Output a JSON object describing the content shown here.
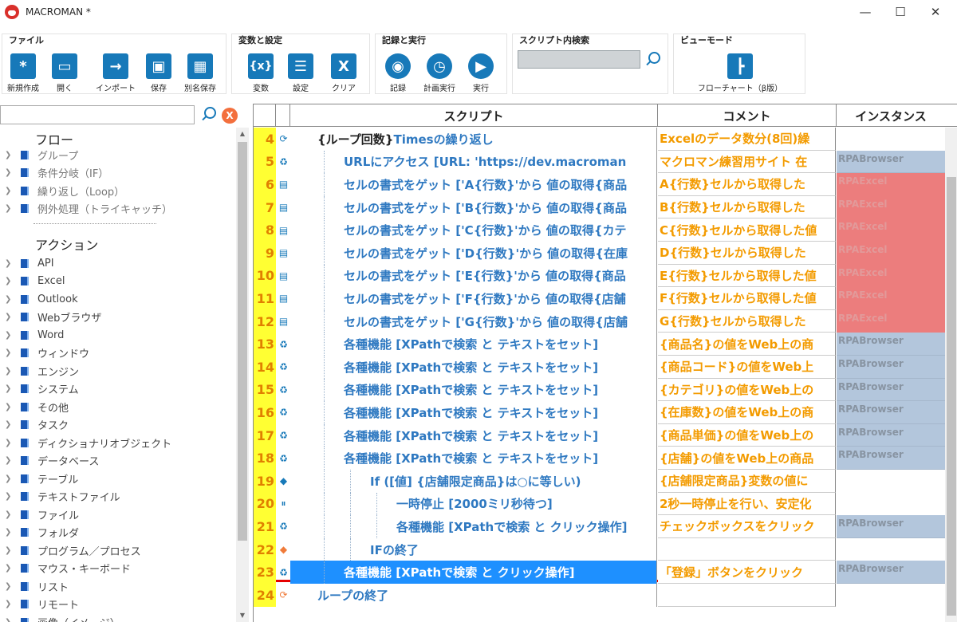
{
  "window": {
    "title": "MACROMAN *"
  },
  "ribbon": {
    "groups": {
      "file": {
        "title": "ファイル",
        "new": "新規作成",
        "open": "開く",
        "import": "インポート",
        "save": "保存",
        "save_as": "別名保存"
      },
      "vars": {
        "title": "変数と設定",
        "variable": "変数",
        "settings": "設定",
        "clear": "クリア"
      },
      "record": {
        "title": "記録と実行",
        "record": "記録",
        "scheduled": "計画実行",
        "run": "実行"
      },
      "search": {
        "title": "スクリプト内検索"
      },
      "view": {
        "title": "ビューモード",
        "flowchart": "フローチャート（β版）"
      }
    }
  },
  "sidebar": {
    "flow_title": "フロー",
    "flow_items": [
      "グループ",
      "条件分岐（IF）",
      "繰り返し（Loop）",
      "例外処理（トライキャッチ）"
    ],
    "action_title": "アクション",
    "action_items": [
      "API",
      "Excel",
      "Outlook",
      "Webブラウザ",
      "Word",
      "ウィンドウ",
      "エンジン",
      "システム",
      "その他",
      "タスク",
      "ディクショナリオブジェクト",
      "データベース",
      "テーブル",
      "テキストファイル",
      "ファイル",
      "フォルダ",
      "プログラム／プロセス",
      "マウス・キーボード",
      "リスト",
      "リモート",
      "画像（イメージ）"
    ]
  },
  "grid": {
    "headers": {
      "script": "スクリプト",
      "comment": "コメント",
      "instance": "インスタンス"
    },
    "rows": [
      {
        "n": "4",
        "icon": "loop-icon",
        "pre": "{ループ回数}",
        "script": " Timesの繰り返し",
        "comment": "Excelのデータ数分(8回)繰",
        "instance": "",
        "itype": "none",
        "indent": 0
      },
      {
        "n": "5",
        "icon": "action-icon",
        "pre": "",
        "script": "URLにアクセス [URL: 'https://dev.macroman",
        "comment": "マクロマン練習用サイト 在",
        "instance": "RPABrowser",
        "itype": "browser",
        "indent": 1
      },
      {
        "n": "6",
        "icon": "doc-icon",
        "pre": "",
        "script": "セルの書式をゲット ['A{行数}'から 値の取得{商品",
        "comment": "A{行数}セルから取得した",
        "instance": "RPAExcel",
        "itype": "excel",
        "indent": 1
      },
      {
        "n": "7",
        "icon": "doc-icon",
        "pre": "",
        "script": "セルの書式をゲット ['B{行数}'から 値の取得{商品",
        "comment": "B{行数}セルから取得した",
        "instance": "RPAExcel",
        "itype": "excel",
        "indent": 1
      },
      {
        "n": "8",
        "icon": "doc-icon",
        "pre": "",
        "script": "セルの書式をゲット ['C{行数}'から 値の取得{カテ",
        "comment": "C{行数}セルから取得した値",
        "instance": "RPAExcel",
        "itype": "excel",
        "indent": 1
      },
      {
        "n": "9",
        "icon": "doc-icon",
        "pre": "",
        "script": "セルの書式をゲット ['D{行数}'から 値の取得{在庫",
        "comment": "D{行数}セルから取得した",
        "instance": "RPAExcel",
        "itype": "excel",
        "indent": 1
      },
      {
        "n": "10",
        "icon": "doc-icon",
        "pre": "",
        "script": "セルの書式をゲット ['E{行数}'から 値の取得{商品",
        "comment": "E{行数}セルから取得した値",
        "instance": "RPAExcel",
        "itype": "excel",
        "indent": 1
      },
      {
        "n": "11",
        "icon": "doc-icon",
        "pre": "",
        "script": "セルの書式をゲット ['F{行数}'から 値の取得{店舗",
        "comment": "F{行数}セルから取得した値",
        "instance": "RPAExcel",
        "itype": "excel",
        "indent": 1
      },
      {
        "n": "12",
        "icon": "doc-icon",
        "pre": "",
        "script": "セルの書式をゲット ['G{行数}'から 値の取得{店舗",
        "comment": "G{行数}セルから取得した",
        "instance": "RPAExcel",
        "itype": "excel",
        "indent": 1
      },
      {
        "n": "13",
        "icon": "action-icon",
        "pre": "",
        "script": "各種機能 [XPathで検索 と テキストをセット]",
        "comment": "{商品名}の値をWeb上の商",
        "instance": "RPABrowser",
        "itype": "browser",
        "indent": 1
      },
      {
        "n": "14",
        "icon": "action-icon",
        "pre": "",
        "script": "各種機能 [XPathで検索 と テキストをセット]",
        "comment": "{商品コード}の値をWeb上",
        "instance": "RPABrowser",
        "itype": "browser",
        "indent": 1
      },
      {
        "n": "15",
        "icon": "action-icon",
        "pre": "",
        "script": "各種機能 [XPathで検索 と テキストをセット]",
        "comment": "{カテゴリ}の値をWeb上の",
        "instance": "RPABrowser",
        "itype": "browser",
        "indent": 1
      },
      {
        "n": "16",
        "icon": "action-icon",
        "pre": "",
        "script": "各種機能 [XPathで検索 と テキストをセット]",
        "comment": "{在庫数}の値をWeb上の商",
        "instance": "RPABrowser",
        "itype": "browser",
        "indent": 1
      },
      {
        "n": "17",
        "icon": "action-icon",
        "pre": "",
        "script": "各種機能 [XPathで検索 と テキストをセット]",
        "comment": "{商品単価}の値をWeb上の",
        "instance": "RPABrowser",
        "itype": "browser",
        "indent": 1
      },
      {
        "n": "18",
        "icon": "action-icon",
        "pre": "",
        "script": "各種機能 [XPathで検索 と テキストをセット]",
        "comment": "{店舗}の値をWeb上の商品",
        "instance": "RPABrowser",
        "itype": "browser",
        "indent": 1
      },
      {
        "n": "19",
        "icon": "if-icon",
        "pre": "",
        "script": "If ([値] {店舗限定商品}は○に等しい)",
        "comment": "{店舗限定商品}変数の値に",
        "instance": "",
        "itype": "none",
        "indent": 2
      },
      {
        "n": "20",
        "icon": "pause-icon",
        "pre": "",
        "script": "一時停止 [2000ミリ秒待つ]",
        "comment": "2秒一時停止を行い、安定化",
        "instance": "",
        "itype": "none",
        "indent": 3
      },
      {
        "n": "21",
        "icon": "action-icon",
        "pre": "",
        "script": "各種機能 [XPathで検索 と クリック操作]",
        "comment": "チェックボックスをクリック",
        "instance": "RPABrowser",
        "itype": "browser",
        "indent": 3
      },
      {
        "n": "22",
        "icon": "endif-icon",
        "pre": "",
        "script": "IFの終了",
        "comment": "",
        "instance": "",
        "itype": "none",
        "indent": 2
      },
      {
        "n": "23",
        "icon": "action-icon",
        "pre": "",
        "script": "各種機能 [XPathで検索 と クリック操作]",
        "comment": "「登録」ボタンをクリック",
        "instance": "RPABrowser",
        "itype": "browser",
        "indent": 1,
        "selected": true
      },
      {
        "n": "24",
        "icon": "loop-end-icon",
        "pre": "",
        "script": "ループの終了",
        "comment": "",
        "instance": "",
        "itype": "none",
        "indent": 0
      }
    ]
  },
  "colors": {
    "accent": "#1779b9",
    "line_number_bg": "#ffff33",
    "comment": "#f39b00",
    "excel_instance": "#ec7d7d",
    "browser_instance": "#b3c6dc",
    "selection": "#1e90ff",
    "insert_marker": "#e60000"
  }
}
